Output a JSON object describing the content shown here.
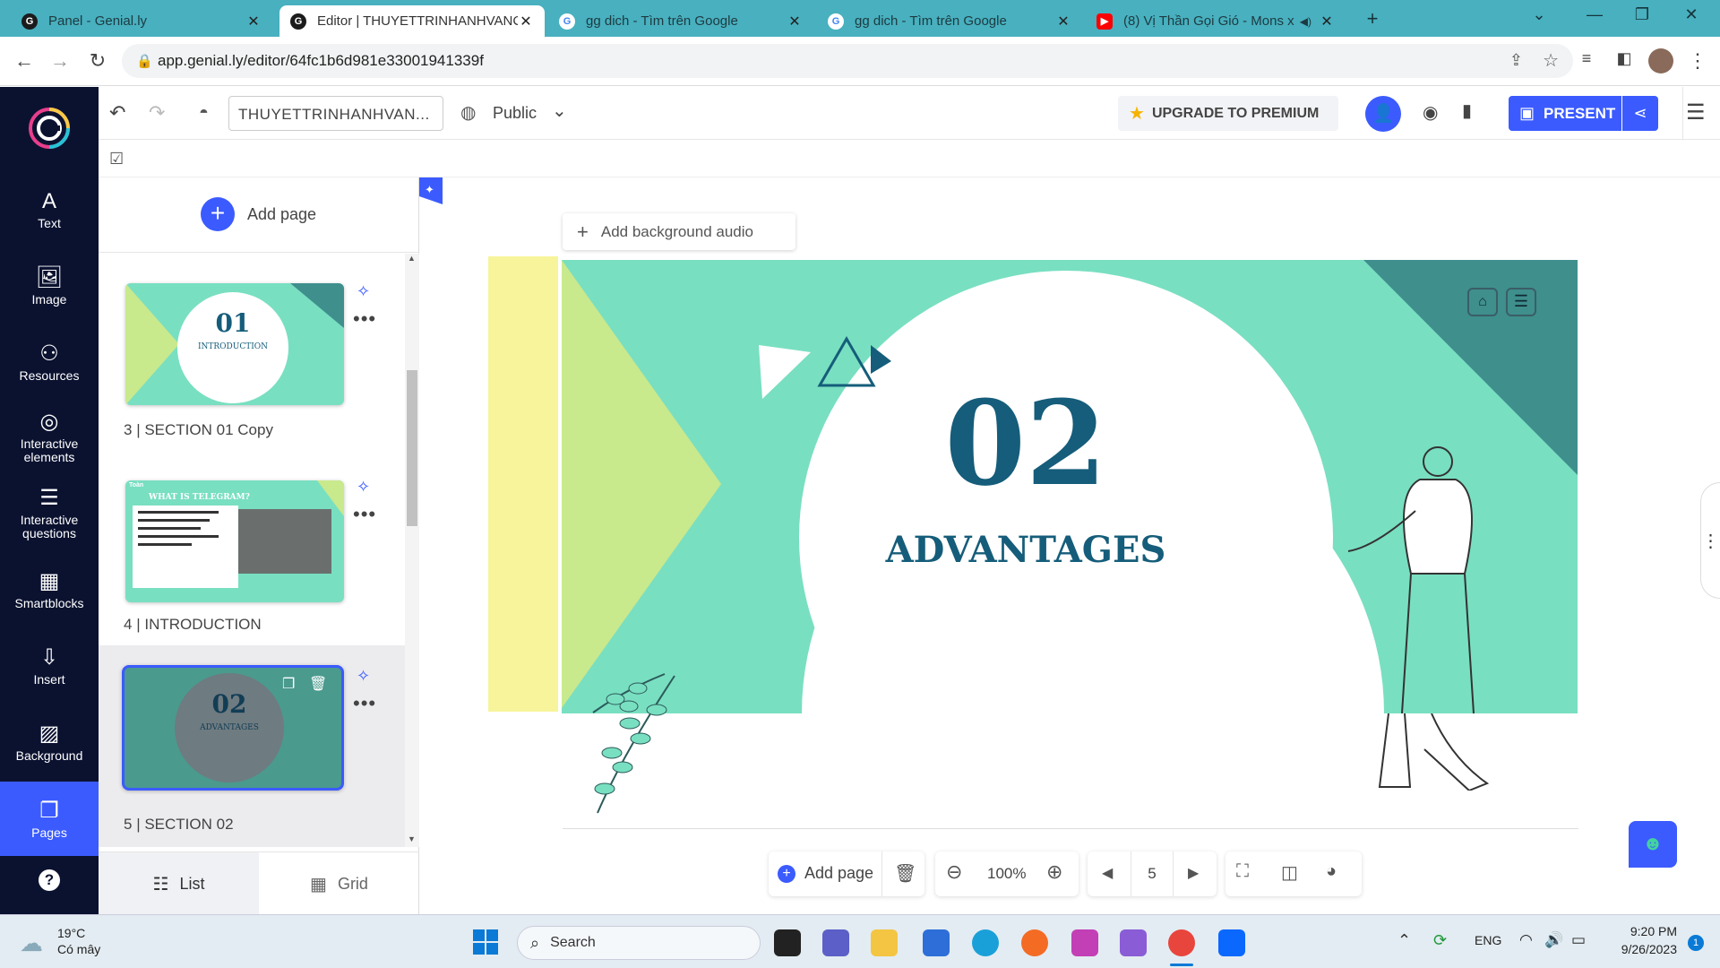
{
  "browser": {
    "tabs": [
      {
        "title": "Panel - Genial.ly",
        "close": "✕"
      },
      {
        "title": "Editor | THUYETTRINHANHVANC",
        "close": "✕"
      },
      {
        "title": "gg dich - Tìm trên Google",
        "close": "✕"
      },
      {
        "title": "gg dich - Tìm trên Google",
        "close": "✕"
      },
      {
        "title": "(8) Vị Thần Gọi Gió - Mons x",
        "close": "✕"
      }
    ],
    "new_tab": "+",
    "url": "app.genial.ly/editor/64fc1b6d981e33001941339f"
  },
  "editor": {
    "title_input": "THUYETTRINHANHVAN...",
    "visibility": "Public",
    "upgrade_label": "UPGRADE TO PREMIUM",
    "present_label": "PRESENT",
    "add_page_label": "Add page",
    "add_audio_label": "Add background audio",
    "accent": "#3b5bff"
  },
  "sidebar": {
    "items": [
      {
        "label": "Text",
        "icon": "A"
      },
      {
        "label": "Image",
        "icon": "🖼"
      },
      {
        "label": "Resources",
        "icon": "⚇"
      },
      {
        "label": "Interactive elements",
        "icon": "◎"
      },
      {
        "label": "Interactive questions",
        "icon": "☰"
      },
      {
        "label": "Smartblocks",
        "icon": "▦"
      },
      {
        "label": "Insert",
        "icon": "⇩"
      },
      {
        "label": "Background",
        "icon": "▨"
      },
      {
        "label": "Pages",
        "icon": "❐"
      }
    ],
    "help": "?"
  },
  "pages": [
    {
      "number": "3",
      "name": "SECTION 01 Copy",
      "thumb_num": "01",
      "thumb_sub": "INTRODUCTION"
    },
    {
      "number": "4",
      "name": "INTRODUCTION",
      "thumb_title": "WHAT IS TELEGRAM?",
      "thumb_tag": "Toàn"
    },
    {
      "number": "5",
      "name": "SECTION 02",
      "thumb_num": "02",
      "thumb_sub": "ADVANTAGES"
    }
  ],
  "view_toggle": {
    "list": "List",
    "grid": "Grid"
  },
  "slide": {
    "number": "02",
    "title": "ADVANTAGES"
  },
  "bottombar": {
    "add_page": "Add page",
    "zoom": "100%",
    "page": "5"
  },
  "taskbar": {
    "weather_temp": "19°C",
    "weather_desc": "Có mây",
    "search": "Search",
    "lang": "ENG",
    "time": "9:20 PM",
    "date": "9/26/2023",
    "badge": "1"
  }
}
